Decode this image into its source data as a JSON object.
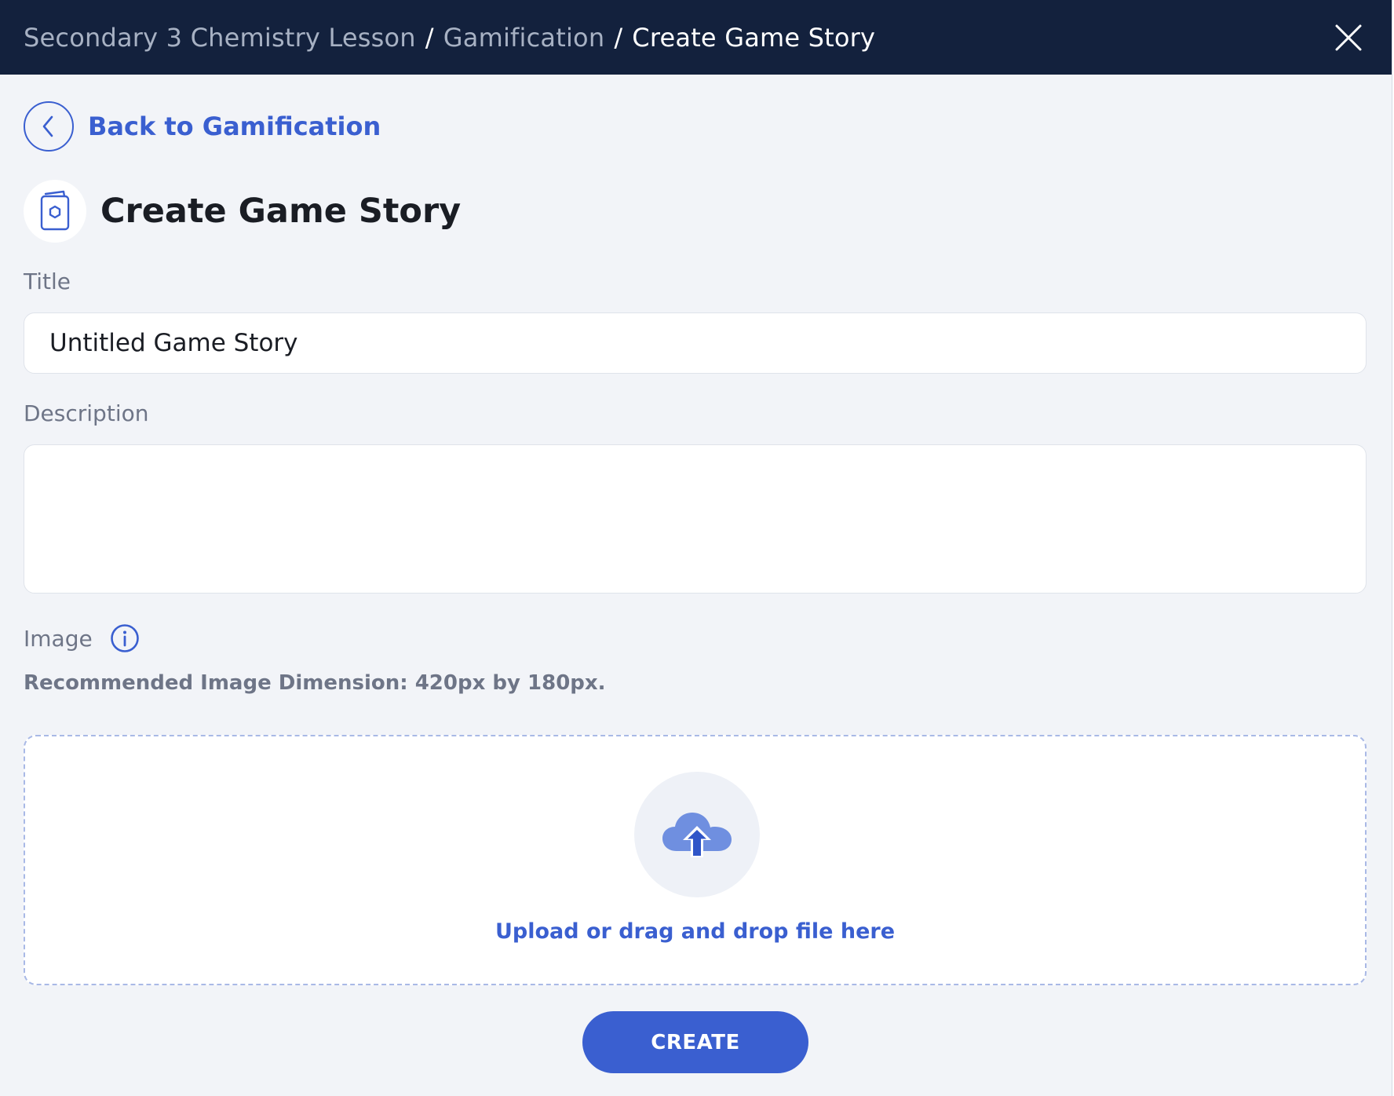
{
  "header": {
    "breadcrumb": [
      "Secondary 3 Chemistry Lesson",
      "Gamification",
      "Create Game Story"
    ],
    "separator": "/",
    "close_icon": "close-icon"
  },
  "back": {
    "label": "Back to Gamification",
    "icon": "chevron-left-icon"
  },
  "page": {
    "title": "Create Game Story",
    "icon": "story-card-icon"
  },
  "form": {
    "title_label": "Title",
    "title_value": "Untitled Game Story",
    "description_label": "Description",
    "description_value": "",
    "image_label": "Image",
    "image_info_icon": "info-icon",
    "recommendation": "Recommended Image Dimension: 420px by 180px.",
    "upload_text": "Upload or drag and drop file here",
    "upload_icon": "cloud-upload-icon"
  },
  "actions": {
    "create_label": "CREATE"
  },
  "colors": {
    "header_bg": "#13213d",
    "accent": "#3a5fd0",
    "page_bg": "#f2f4f8",
    "muted_text": "#6e7587"
  }
}
